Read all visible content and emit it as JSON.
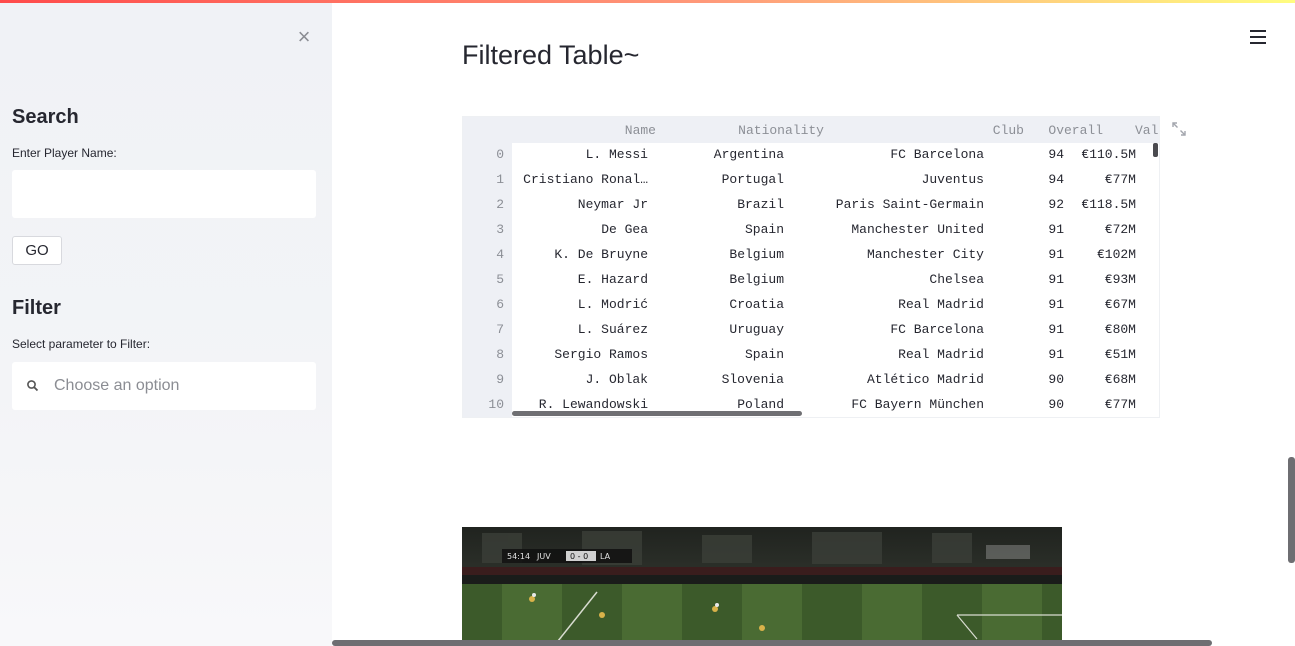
{
  "sidebar": {
    "close_icon": "close-icon",
    "search_heading": "Search",
    "player_label": "Enter Player Name:",
    "player_value": "",
    "go_label": "GO",
    "filter_heading": "Filter",
    "filter_label": "Select parameter to Filter:",
    "filter_placeholder": "Choose an option"
  },
  "main": {
    "title": "Filtered Table~",
    "menu_icon": "hamburger-icon",
    "expand_icon": "expand-icon"
  },
  "table": {
    "columns": [
      "Name",
      "Nationality",
      "Club",
      "Overall",
      "Val"
    ],
    "rows": [
      {
        "index": "0",
        "name": "L. Messi",
        "nationality": "Argentina",
        "club": "FC Barcelona",
        "overall": "94",
        "value": "€110.5M"
      },
      {
        "index": "1",
        "name": "Cristiano Ronal…",
        "nationality": "Portugal",
        "club": "Juventus",
        "overall": "94",
        "value": "€77M"
      },
      {
        "index": "2",
        "name": "Neymar Jr",
        "nationality": "Brazil",
        "club": "Paris Saint-Germain",
        "overall": "92",
        "value": "€118.5M"
      },
      {
        "index": "3",
        "name": "De Gea",
        "nationality": "Spain",
        "club": "Manchester United",
        "overall": "91",
        "value": "€72M"
      },
      {
        "index": "4",
        "name": "K. De Bruyne",
        "nationality": "Belgium",
        "club": "Manchester City",
        "overall": "91",
        "value": "€102M"
      },
      {
        "index": "5",
        "name": "E. Hazard",
        "nationality": "Belgium",
        "club": "Chelsea",
        "overall": "91",
        "value": "€93M"
      },
      {
        "index": "6",
        "name": "L. Modrić",
        "nationality": "Croatia",
        "club": "Real Madrid",
        "overall": "91",
        "value": "€67M"
      },
      {
        "index": "7",
        "name": "L. Suárez",
        "nationality": "Uruguay",
        "club": "FC Barcelona",
        "overall": "91",
        "value": "€80M"
      },
      {
        "index": "8",
        "name": "Sergio Ramos",
        "nationality": "Spain",
        "club": "Real Madrid",
        "overall": "91",
        "value": "€51M"
      },
      {
        "index": "9",
        "name": "J. Oblak",
        "nationality": "Slovenia",
        "club": "Atlético Madrid",
        "overall": "90",
        "value": "€68M"
      },
      {
        "index": "10",
        "name": "R. Lewandowski",
        "nationality": "Poland",
        "club": "FC Bayern München",
        "overall": "90",
        "value": "€77M"
      }
    ]
  },
  "image": {
    "scoreboard_time": "54:14",
    "home_team": "JUV",
    "score": "0 - 0",
    "away_team": "LA"
  }
}
